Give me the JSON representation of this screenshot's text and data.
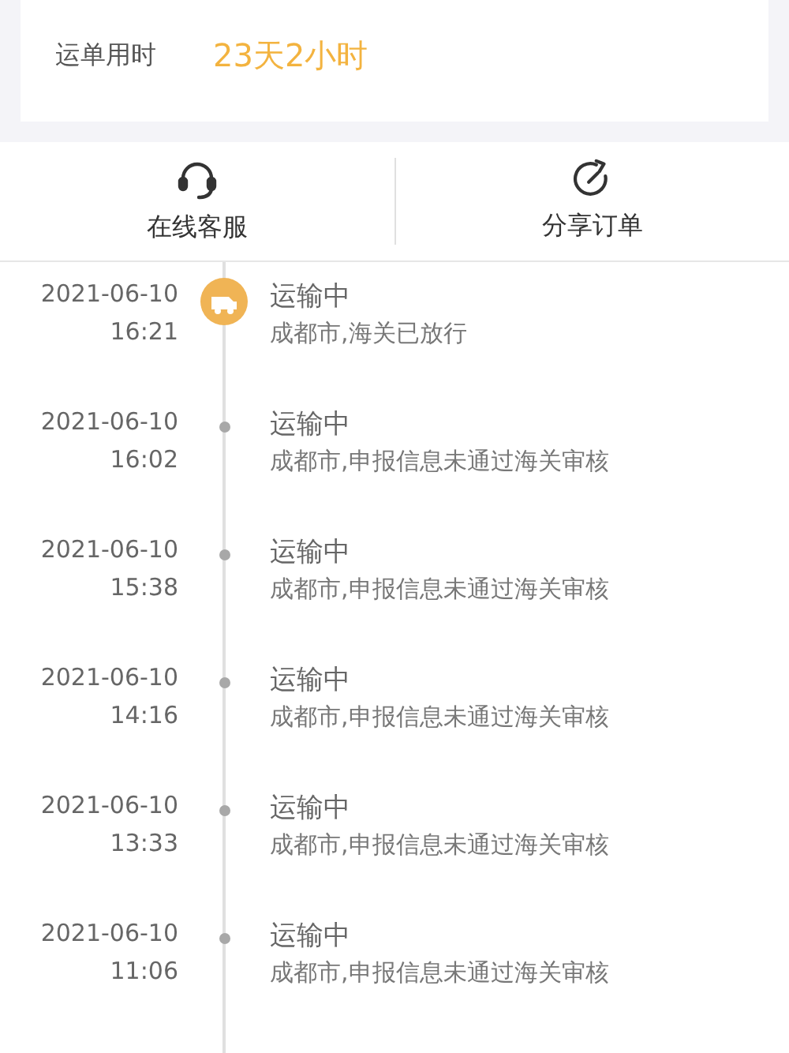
{
  "summary": {
    "label": "运单用时",
    "value": "23天2小时"
  },
  "actions": [
    {
      "kind": "headset",
      "label": "在线客服"
    },
    {
      "kind": "share",
      "label": "分享订单"
    }
  ],
  "timeline": [
    {
      "kind": "current",
      "date": "2021-06-10",
      "time": "16:21",
      "status": "运输中",
      "detail": "成都市,海关已放行"
    },
    {
      "kind": "past",
      "date": "2021-06-10",
      "time": "16:02",
      "status": "运输中",
      "detail": "成都市,申报信息未通过海关审核"
    },
    {
      "kind": "past",
      "date": "2021-06-10",
      "time": "15:38",
      "status": "运输中",
      "detail": "成都市,申报信息未通过海关审核"
    },
    {
      "kind": "past",
      "date": "2021-06-10",
      "time": "14:16",
      "status": "运输中",
      "detail": "成都市,申报信息未通过海关审核"
    },
    {
      "kind": "past",
      "date": "2021-06-10",
      "time": "13:33",
      "status": "运输中",
      "detail": "成都市,申报信息未通过海关审核"
    },
    {
      "kind": "past",
      "date": "2021-06-10",
      "time": "11:06",
      "status": "运输中",
      "detail": "成都市,申报信息未通过海关审核"
    }
  ]
}
